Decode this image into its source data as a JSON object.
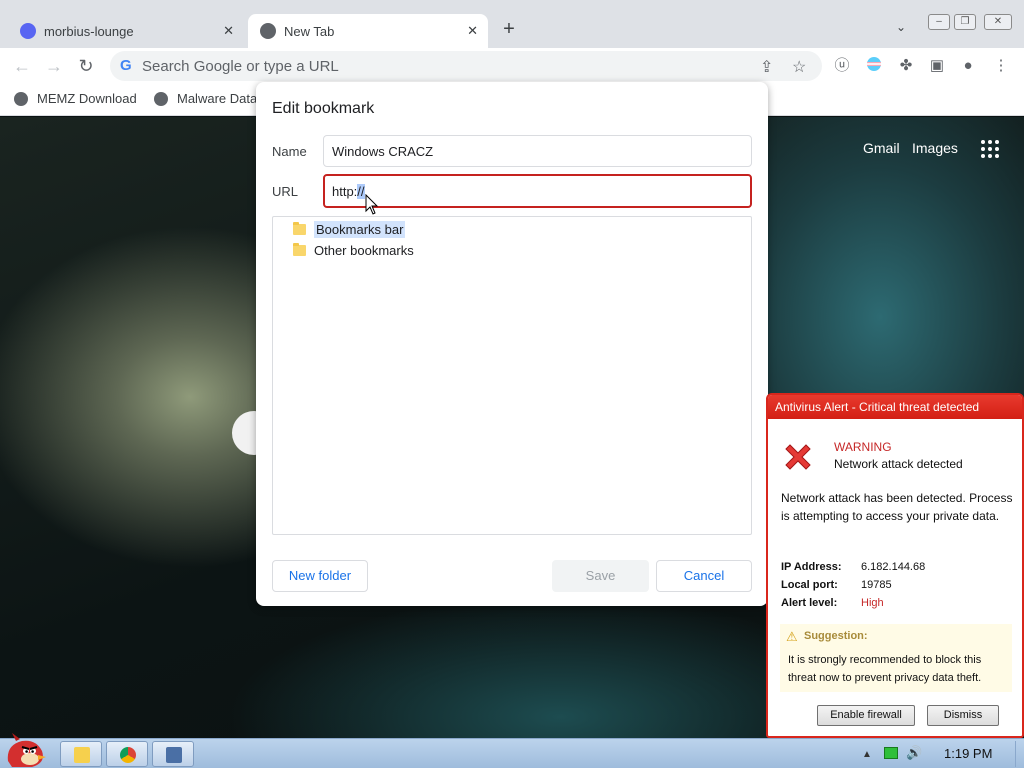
{
  "browser": {
    "tabs": [
      {
        "title": "morbius-lounge",
        "favicon_color": "#5865f2"
      },
      {
        "title": "New Tab",
        "favicon_color": "#5f6368"
      }
    ],
    "new_tab_symbol": "+",
    "close_symbol": "✕",
    "tab_search_symbol": "⌄",
    "window_buttons": {
      "minimize": "–",
      "restore": "❐",
      "close": "✕"
    },
    "nav": {
      "back": "←",
      "forward": "→",
      "reload": "↻"
    },
    "omnibox": {
      "logo": "G",
      "placeholder": "Search Google or type a URL"
    },
    "omni_icons": {
      "share": "⇪",
      "star": "☆"
    },
    "toolbar_icons": {
      "ublock": "ⓤ",
      "extensions": "✤",
      "sidepanel": "▣",
      "profile": "●",
      "menu": "⋮"
    },
    "bookmarks": [
      {
        "label": "MEMZ Download"
      },
      {
        "label": "Malware Data"
      }
    ]
  },
  "page": {
    "gmail": "Gmail",
    "images": "Images"
  },
  "dialog": {
    "title": "Edit bookmark",
    "name_label": "Name",
    "name_value": "Windows CRACZ",
    "url_label": "URL",
    "url_prefix": "http:",
    "url_selected": "//",
    "folders": [
      {
        "label": "Bookmarks bar",
        "selected": true
      },
      {
        "label": "Other bookmarks",
        "selected": false
      }
    ],
    "new_folder": "New folder",
    "save": "Save",
    "cancel": "Cancel"
  },
  "antivirus": {
    "header": "Antivirus Alert - Critical threat detected",
    "warning": "WARNING",
    "subtitle": "Network attack detected",
    "body": "Network attack has been detected. Process is attempting to access your private data.",
    "details": [
      {
        "label": "IP Address:",
        "value": "6.182.144.68",
        "color": "#111111"
      },
      {
        "label": "Local port:",
        "value": "19785",
        "color": "#111111"
      },
      {
        "label": "Alert level:",
        "value": "High",
        "color": "#c62828"
      }
    ],
    "suggestion_icon": "⚠",
    "suggestion_title": "Suggestion:",
    "suggestion_text": "It is strongly recommended to block this threat now to prevent privacy data theft.",
    "enable_firewall": "Enable firewall",
    "dismiss": "Dismiss",
    "accent": "#d9261c"
  },
  "taskbar": {
    "clock": "1:19 PM",
    "tray_flag": "▲",
    "tray_volume": "🔊"
  }
}
